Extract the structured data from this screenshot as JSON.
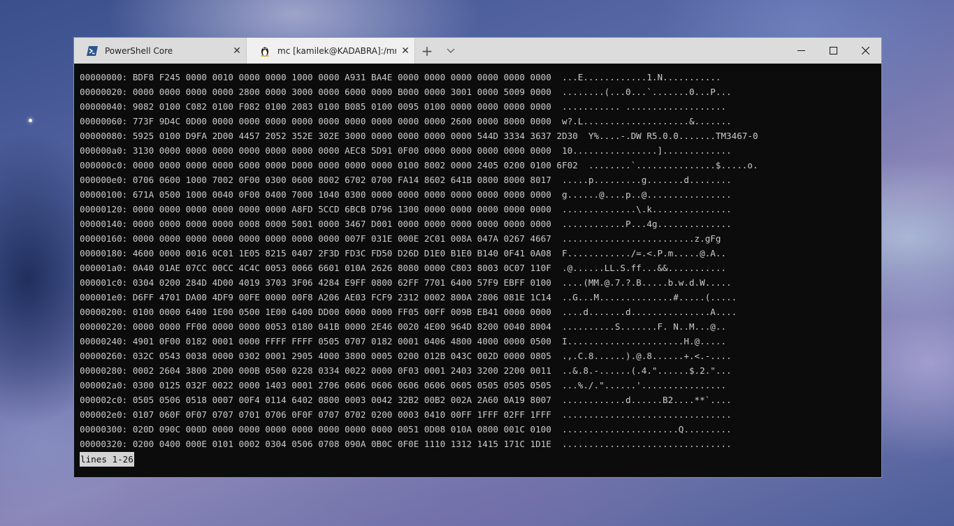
{
  "tabs": [
    {
      "title": "PowerShell Core",
      "icon": "powershell-icon"
    },
    {
      "title": "mc [kamilek@KADABRA]:/mnt/c",
      "icon": "tux-linux-icon"
    }
  ],
  "titlebar": {
    "new_tab": "+",
    "dropdown_icon": "chevron-down-icon",
    "close_tab_glyph": "✕"
  },
  "window_controls": {
    "minimize": "minimize-icon",
    "maximize": "maximize-icon",
    "close": "close-icon"
  },
  "hexdump": [
    {
      "offset": "00000000:",
      "hex": "BDF8 F245 0000 0010 0000 0000 1000 0000 A931 BA4E 0000 0000 0000 0000 0000 0000",
      "ascii": "...E............1.N..........."
    },
    {
      "offset": "00000020:",
      "hex": "0000 0000 0000 0000 2800 0000 3000 0000 6000 0000 B000 0000 3001 0000 5009 0000",
      "ascii": "........(...0...`.......0...P..."
    },
    {
      "offset": "00000040:",
      "hex": "9082 0100 C082 0100 F082 0100 2083 0100 B085 0100 0095 0100 0000 0000 0000 0000",
      "ascii": "........... ..................."
    },
    {
      "offset": "00000060:",
      "hex": "773F 9D4C 0D00 0000 0000 0000 0000 0000 0000 0000 0000 0000 2600 0000 8000 0000",
      "ascii": "w?.L....................&......."
    },
    {
      "offset": "00000080:",
      "hex": "5925 0100 D9FA 2D00 4457 2052 352E 302E 3000 0000 0000 0000 0000 544D 3334 3637 2D30",
      "ascii": "Y%....-.DW R5.0.0.......TM3467-0"
    },
    {
      "offset": "000000a0:",
      "hex": "3130 0000 0000 0000 0000 0000 0000 0000 AEC8 5D91 0F00 0000 0000 0000 0000 0000",
      "ascii": "10................]............."
    },
    {
      "offset": "000000c0:",
      "hex": "0000 0000 0000 0000 6000 0000 D000 0000 0000 0000 0100 8002 0000 2405 0200 0100 6F02",
      "ascii": "........`...............$.....o."
    },
    {
      "offset": "000000e0:",
      "hex": "0706 0600 1000 7002 0F00 0300 0600 8002 6702 0700 FA14 8602 641B 0800 8000 8017",
      "ascii": ".....p.........g.......d........"
    },
    {
      "offset": "00000100:",
      "hex": "671A 0500 1000 0040 0F00 0400 7000 1040 0300 0000 0000 0000 0000 0000 0000 0000",
      "ascii": "g......@....p..@................"
    },
    {
      "offset": "00000120:",
      "hex": "0000 0000 0000 0000 0000 0000 A8FD 5CCD 6BCB D796 1300 0000 0000 0000 0000 0000",
      "ascii": "..............\\.k..............."
    },
    {
      "offset": "00000140:",
      "hex": "0000 0000 0000 0000 0008 0000 5001 0000 3467 D001 0000 0000 0000 0000 0000 0000",
      "ascii": "............P...4g.............."
    },
    {
      "offset": "00000160:",
      "hex": "0000 0000 0000 0000 0000 0000 0000 0000 007F 031E 000E 2C01 008A 047A 0267 4667",
      "ascii": ".........................z.gFg"
    },
    {
      "offset": "00000180:",
      "hex": "4600 0000 0016 0C01 1E05 8215 0407 2F3D FD3C FD50 D26D D1E0 B1E0 B140 0F41 0A08",
      "ascii": "F............/=.<.P.m.....@.A.."
    },
    {
      "offset": "000001a0:",
      "hex": "0A40 01AE 07CC 00CC 4C4C 0053 0066 6601 010A 2626 8080 0000 C803 8003 0C07 110F",
      "ascii": ".@......LL.S.ff...&&..........."
    },
    {
      "offset": "000001c0:",
      "hex": "0304 0200 284D 4D00 4019 3703 3F06 4284 E9FF 0800 62FF 7701 6400 57F9 EBFF 0100",
      "ascii": "....(MM.@.7.?.B.....b.w.d.W....."
    },
    {
      "offset": "000001e0:",
      "hex": "D6FF 4701 DA00 4DF9 00FE 0000 00F8 A206 AE03 FCF9 2312 0002 800A 2806 081E 1C14",
      "ascii": "..G...M..............#.....(....."
    },
    {
      "offset": "00000200:",
      "hex": "0100 0000 6400 1E00 0500 1E00 6400 DD00 0000 0000 FF05 00FF 009B EB41 0000 0000",
      "ascii": "....d.......d...............A...."
    },
    {
      "offset": "00000220:",
      "hex": "0000 0000 FF00 0000 0000 0053 0180 041B 0000 2E46 0020 4E00 964D 8200 0040 8004",
      "ascii": "..........S.......F. N..M...@.."
    },
    {
      "offset": "00000240:",
      "hex": "4901 0F00 0182 0001 0000 FFFF FFFF 0505 0707 0182 0001 0406 4800 4000 0000 0500",
      "ascii": "I......................H.@....."
    },
    {
      "offset": "00000260:",
      "hex": "032C 0543 0038 0000 0302 0001 2905 4000 3800 0005 0200 012B 043C 002D 0000 0805",
      "ascii": ".,.C.8......).@.8......+.<.-...."
    },
    {
      "offset": "00000280:",
      "hex": "0002 2604 3800 2D00 000B 0500 0228 0334 0022 0000 0F03 0001 2403 3200 2200 0011",
      "ascii": "..&.8.-......(.4.\"......$.2.\"..."
    },
    {
      "offset": "000002a0:",
      "hex": "0300 0125 032F 0022 0000 1403 0001 2706 0606 0606 0606 0606 0605 0505 0505 0505",
      "ascii": "...%./.\"......'................"
    },
    {
      "offset": "000002c0:",
      "hex": "0505 0506 0518 0007 00F4 0114 6402 0800 0003 0042 32B2 00B2 002A 2A60 0A19 8007",
      "ascii": "............d......B2....**`...."
    },
    {
      "offset": "000002e0:",
      "hex": "0107 060F 0F07 0707 0701 0706 0F0F 0707 0702 0200 0003 0410 00FF 1FFF 02FF 1FFF",
      "ascii": "................................"
    },
    {
      "offset": "00000300:",
      "hex": "020D 090C 000D 0000 0000 0000 0000 0000 0000 0000 0051 0D08 010A 0800 001C 0100",
      "ascii": "......................Q........."
    },
    {
      "offset": "00000320:",
      "hex": "0200 0400 000E 0101 0002 0304 0506 0708 090A 0B0C 0F0E 1110 1312 1415 171C 1D1E",
      "ascii": "................................"
    }
  ],
  "status": {
    "text": "lines 1-26"
  }
}
